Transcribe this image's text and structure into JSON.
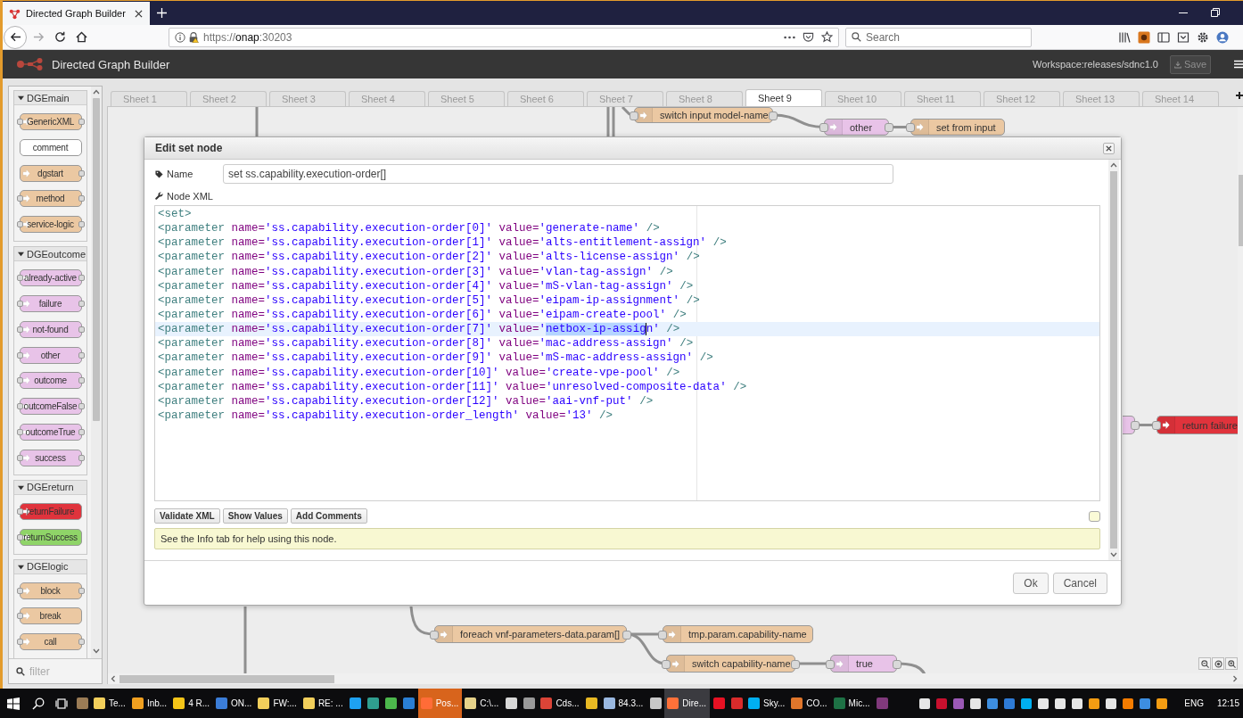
{
  "browser": {
    "tabs": [
      {
        "title": "Directed Graph Builder",
        "selected": true
      }
    ],
    "forward": {
      "disabled": true
    },
    "url": {
      "scheme": "https://",
      "host": "onap",
      "port": ":30203"
    },
    "search": {
      "placeholder": "Search"
    }
  },
  "app": {
    "title": "Directed Graph Builder",
    "workspace": "Workspace:releases/sdnc1.0",
    "save_button": {
      "label": "Save",
      "disabled": true
    }
  },
  "palette": {
    "categories": [
      {
        "name": "DGEmain",
        "expanded": true,
        "nodes": [
          {
            "label": "GenericXML",
            "kind": "node",
            "color": "#ebc8a2",
            "input": true,
            "output": true
          },
          {
            "label": "comment",
            "kind": "comment",
            "color": "#ffffff",
            "input": false,
            "output": false
          },
          {
            "label": "dgstart",
            "kind": "node",
            "color": "#ebc8a2",
            "input": false,
            "output": true
          },
          {
            "label": "method",
            "kind": "node",
            "color": "#ebc8a2",
            "input": true,
            "output": true
          },
          {
            "label": "service-logic",
            "kind": "node",
            "color": "#ebc8a2",
            "input": true,
            "output": true
          }
        ]
      },
      {
        "name": "DGEoutcome",
        "expanded": true,
        "nodes": [
          {
            "label": "already-active",
            "kind": "node",
            "color": "#e8c3e8",
            "input": true,
            "output": true
          },
          {
            "label": "failure",
            "kind": "node",
            "color": "#e8c3e8",
            "input": true,
            "output": true
          },
          {
            "label": "not-found",
            "kind": "node",
            "color": "#e8c3e8",
            "input": true,
            "output": true
          },
          {
            "label": "other",
            "kind": "node",
            "color": "#e8c3e8",
            "input": true,
            "output": true
          },
          {
            "label": "outcome",
            "kind": "node",
            "color": "#e8c3e8",
            "input": true,
            "output": true
          },
          {
            "label": "outcomeFalse",
            "kind": "node",
            "color": "#e8c3e8",
            "input": true,
            "output": true
          },
          {
            "label": "outcomeTrue",
            "kind": "node",
            "color": "#e8c3e8",
            "input": true,
            "output": true
          },
          {
            "label": "success",
            "kind": "node",
            "color": "#e8c3e8",
            "input": true,
            "output": true
          }
        ]
      },
      {
        "name": "DGEreturn",
        "expanded": true,
        "nodes": [
          {
            "label": "returnFailure",
            "kind": "node",
            "color": "#e0333c",
            "input": true,
            "output": false
          },
          {
            "label": "returnSuccess",
            "kind": "node",
            "color": "#8fd468",
            "input": true,
            "output": false
          }
        ]
      },
      {
        "name": "DGElogic",
        "expanded": true,
        "nodes": [
          {
            "label": "block",
            "kind": "node",
            "color": "#ebc8a2",
            "input": true,
            "output": true
          },
          {
            "label": "break",
            "kind": "node",
            "color": "#ebc8a2",
            "input": true,
            "output": false
          },
          {
            "label": "call",
            "kind": "node",
            "color": "#ebc8a2",
            "input": true,
            "output": true
          }
        ]
      }
    ],
    "filter": {
      "placeholder": "filter"
    }
  },
  "sheets": {
    "tabs": [
      {
        "label": "Sheet 1",
        "selected": false
      },
      {
        "label": "Sheet 2",
        "selected": false
      },
      {
        "label": "Sheet 3",
        "selected": false
      },
      {
        "label": "Sheet 4",
        "selected": false
      },
      {
        "label": "Sheet 5",
        "selected": false
      },
      {
        "label": "Sheet 6",
        "selected": false
      },
      {
        "label": "Sheet 7",
        "selected": false
      },
      {
        "label": "Sheet 8",
        "selected": false
      },
      {
        "label": "Sheet 9",
        "selected": true
      },
      {
        "label": "Sheet 10",
        "selected": false
      },
      {
        "label": "Sheet 11",
        "selected": false
      },
      {
        "label": "Sheet 12",
        "selected": false
      },
      {
        "label": "Sheet 13",
        "selected": false
      },
      {
        "label": "Sheet 14",
        "selected": false
      }
    ]
  },
  "canvas": {
    "nodes": [
      {
        "label": "switch input model-name",
        "color": "#ebc8a2",
        "input": true,
        "output": true
      },
      {
        "label": "other",
        "color": "#e8c3e8",
        "input": true,
        "output": true
      },
      {
        "label": "set from input",
        "color": "#ebc8a2",
        "input": true,
        "output": false
      },
      {
        "color": "#e8c3e8",
        "input": false,
        "output": true
      },
      {
        "label": "return failure",
        "color": "#e0333c",
        "input": true,
        "output": false
      },
      {
        "label": "foreach vnf-parameters-data.param[]",
        "color": "#ebc8a2",
        "input": true,
        "output": true
      },
      {
        "label": "tmp.param.capability-name",
        "color": "#ebc8a2",
        "input": true,
        "output": false
      },
      {
        "label": "switch capability-name",
        "color": "#ebc8a2",
        "input": true,
        "output": true
      },
      {
        "label": "true",
        "color": "#e8c3e8",
        "input": true,
        "output": true
      }
    ]
  },
  "dialog": {
    "title": "Edit set node",
    "name_field": {
      "label": "Name",
      "value": "set ss.capability.execution-order[]"
    },
    "editor": {
      "label": "Node XML",
      "lines": [
        {
          "current": false,
          "tokens": [
            {
              "kind": "tag",
              "text": "<set>"
            }
          ]
        },
        {
          "current": false,
          "tokens": [
            {
              "kind": "tag",
              "text": "<parameter"
            },
            {
              "kind": "attr",
              "text": " name="
            },
            {
              "kind": "string",
              "text": "'ss.capability.execution-order[0]'"
            },
            {
              "kind": "attr",
              "text": " value="
            },
            {
              "kind": "string",
              "text": "'generate-name'"
            },
            {
              "kind": "tag",
              "text": " />"
            }
          ]
        },
        {
          "current": false,
          "tokens": [
            {
              "kind": "tag",
              "text": "<parameter"
            },
            {
              "kind": "attr",
              "text": " name="
            },
            {
              "kind": "string",
              "text": "'ss.capability.execution-order[1]'"
            },
            {
              "kind": "attr",
              "text": " value="
            },
            {
              "kind": "string",
              "text": "'alts-entitlement-assign'"
            },
            {
              "kind": "tag",
              "text": " />"
            }
          ]
        },
        {
          "current": false,
          "tokens": [
            {
              "kind": "tag",
              "text": "<parameter"
            },
            {
              "kind": "attr",
              "text": " name="
            },
            {
              "kind": "string",
              "text": "'ss.capability.execution-order[2]'"
            },
            {
              "kind": "attr",
              "text": " value="
            },
            {
              "kind": "string",
              "text": "'alts-license-assign'"
            },
            {
              "kind": "tag",
              "text": " />"
            }
          ]
        },
        {
          "current": false,
          "tokens": [
            {
              "kind": "tag",
              "text": "<parameter"
            },
            {
              "kind": "attr",
              "text": " name="
            },
            {
              "kind": "string",
              "text": "'ss.capability.execution-order[3]'"
            },
            {
              "kind": "attr",
              "text": " value="
            },
            {
              "kind": "string",
              "text": "'vlan-tag-assign'"
            },
            {
              "kind": "tag",
              "text": " />"
            }
          ]
        },
        {
          "current": false,
          "tokens": [
            {
              "kind": "tag",
              "text": "<parameter"
            },
            {
              "kind": "attr",
              "text": " name="
            },
            {
              "kind": "string",
              "text": "'ss.capability.execution-order[4]'"
            },
            {
              "kind": "attr",
              "text": " value="
            },
            {
              "kind": "string",
              "text": "'mS-vlan-tag-assign'"
            },
            {
              "kind": "tag",
              "text": " />"
            }
          ]
        },
        {
          "current": false,
          "tokens": [
            {
              "kind": "tag",
              "text": "<parameter"
            },
            {
              "kind": "attr",
              "text": " name="
            },
            {
              "kind": "string",
              "text": "'ss.capability.execution-order[5]'"
            },
            {
              "kind": "attr",
              "text": " value="
            },
            {
              "kind": "string",
              "text": "'eipam-ip-assignment'"
            },
            {
              "kind": "tag",
              "text": " />"
            }
          ]
        },
        {
          "current": false,
          "tokens": [
            {
              "kind": "tag",
              "text": "<parameter"
            },
            {
              "kind": "attr",
              "text": " name="
            },
            {
              "kind": "string",
              "text": "'ss.capability.execution-order[6]'"
            },
            {
              "kind": "attr",
              "text": " value="
            },
            {
              "kind": "string",
              "text": "'eipam-create-pool'"
            },
            {
              "kind": "tag",
              "text": " />"
            }
          ]
        },
        {
          "current": true,
          "tokens": [
            {
              "kind": "tag",
              "text": "<parameter"
            },
            {
              "kind": "attr",
              "text": " name="
            },
            {
              "kind": "string",
              "text": "'ss.capability.execution-order[7]'"
            },
            {
              "kind": "attr",
              "text": " value="
            },
            {
              "kind": "string",
              "text": "'"
            },
            {
              "kind": "selection",
              "text": "netbox-ip-assig"
            },
            {
              "kind": "string",
              "text": "n'"
            },
            {
              "kind": "tag",
              "text": " />"
            }
          ]
        },
        {
          "current": false,
          "tokens": [
            {
              "kind": "tag",
              "text": "<parameter"
            },
            {
              "kind": "attr",
              "text": " name="
            },
            {
              "kind": "string",
              "text": "'ss.capability.execution-order[8]'"
            },
            {
              "kind": "attr",
              "text": " value="
            },
            {
              "kind": "string",
              "text": "'mac-address-assign'"
            },
            {
              "kind": "tag",
              "text": " />"
            }
          ]
        },
        {
          "current": false,
          "tokens": [
            {
              "kind": "tag",
              "text": "<parameter"
            },
            {
              "kind": "attr",
              "text": " name="
            },
            {
              "kind": "string",
              "text": "'ss.capability.execution-order[9]'"
            },
            {
              "kind": "attr",
              "text": " value="
            },
            {
              "kind": "string",
              "text": "'mS-mac-address-assign'"
            },
            {
              "kind": "tag",
              "text": " />"
            }
          ]
        },
        {
          "current": false,
          "tokens": [
            {
              "kind": "tag",
              "text": "<parameter"
            },
            {
              "kind": "attr",
              "text": " name="
            },
            {
              "kind": "string",
              "text": "'ss.capability.execution-order[10]'"
            },
            {
              "kind": "attr",
              "text": " value="
            },
            {
              "kind": "string",
              "text": "'create-vpe-pool'"
            },
            {
              "kind": "tag",
              "text": " />"
            }
          ]
        },
        {
          "current": false,
          "tokens": [
            {
              "kind": "tag",
              "text": "<parameter"
            },
            {
              "kind": "attr",
              "text": " name="
            },
            {
              "kind": "string",
              "text": "'ss.capability.execution-order[11]'"
            },
            {
              "kind": "attr",
              "text": " value="
            },
            {
              "kind": "string",
              "text": "'unresolved-composite-data'"
            },
            {
              "kind": "tag",
              "text": " />"
            }
          ]
        },
        {
          "current": false,
          "tokens": [
            {
              "kind": "tag",
              "text": "<parameter"
            },
            {
              "kind": "attr",
              "text": " name="
            },
            {
              "kind": "string",
              "text": "'ss.capability.execution-order[12]'"
            },
            {
              "kind": "attr",
              "text": " value="
            },
            {
              "kind": "string",
              "text": "'aai-vnf-put'"
            },
            {
              "kind": "tag",
              "text": " />"
            }
          ]
        },
        {
          "current": false,
          "tokens": [
            {
              "kind": "tag",
              "text": "<parameter"
            },
            {
              "kind": "attr",
              "text": " name="
            },
            {
              "kind": "string",
              "text": "'ss.capability.execution-order_length'"
            },
            {
              "kind": "attr",
              "text": " value="
            },
            {
              "kind": "string",
              "text": "'13'"
            },
            {
              "kind": "tag",
              "text": " />"
            }
          ]
        }
      ]
    },
    "tools": [
      {
        "label": "Validate XML"
      },
      {
        "label": "Show Values"
      },
      {
        "label": "Add Comments"
      }
    ],
    "tip": "See the Info tab for help using this node.",
    "buttons": [
      {
        "label": "Ok"
      },
      {
        "label": "Cancel"
      }
    ]
  },
  "taskbar": {
    "apps": [
      {
        "color": "#9a7b55",
        "active": false,
        "flashing": false
      },
      {
        "label": "Te...",
        "color": "#f2cf5b",
        "active": false,
        "flashing": false
      },
      {
        "label": "Inb...",
        "color": "#f0a020",
        "active": false,
        "flashing": false
      },
      {
        "label": "4 R...",
        "color": "#f5c518",
        "active": false,
        "flashing": false
      },
      {
        "label": "ON...",
        "color": "#3b7dd8",
        "active": false,
        "flashing": false
      },
      {
        "label": "FW:...",
        "color": "#f2cf5b",
        "active": false,
        "flashing": false
      },
      {
        "label": "RE: ...",
        "color": "#f2cf5b",
        "active": false,
        "flashing": false
      },
      {
        "color": "#1ea1f1",
        "active": false,
        "flashing": false
      },
      {
        "color": "#2f9e8f",
        "active": false,
        "flashing": false
      },
      {
        "color": "#4cb84c",
        "active": false,
        "flashing": false
      },
      {
        "color": "#2a7fd4",
        "active": false,
        "flashing": false
      },
      {
        "label": "Pos...",
        "color": "#ff6c37",
        "active": false,
        "flashing": true
      },
      {
        "label": "C:\\...",
        "color": "#e6d28a",
        "active": false,
        "flashing": false
      },
      {
        "color": "#d8d8d8",
        "active": false,
        "flashing": false
      },
      {
        "color": "#9a9a9a",
        "active": false,
        "flashing": false
      },
      {
        "label": "Cds...",
        "color": "#db4437",
        "active": false,
        "flashing": false
      },
      {
        "color": "#e8b923",
        "active": false,
        "flashing": false
      },
      {
        "label": "84.3...",
        "color": "#9ab8e0",
        "active": false,
        "flashing": false
      },
      {
        "color": "#c8c8c8",
        "active": false,
        "flashing": false
      },
      {
        "label": "Dire...",
        "color": "#ff7139",
        "active": true,
        "flashing": false
      },
      {
        "color": "#e81123",
        "active": false,
        "flashing": false
      },
      {
        "color": "#d92b2b",
        "active": false,
        "flashing": false
      },
      {
        "label": "Sky...",
        "color": "#00aff0",
        "active": false,
        "flashing": false
      },
      {
        "label": "CO...",
        "color": "#e0762b",
        "active": false,
        "flashing": false
      },
      {
        "label": "Mic...",
        "color": "#1e7145",
        "active": false,
        "flashing": false
      },
      {
        "color": "#80397b",
        "active": false,
        "flashing": false
      }
    ],
    "tray": [
      {
        "color": "#e6e6e6"
      },
      {
        "color": "#c8102e"
      },
      {
        "color": "#9b59b6"
      },
      {
        "color": "#e6e6e6"
      },
      {
        "color": "#3d8ee0"
      },
      {
        "color": "#2e7bd6"
      },
      {
        "color": "#00aff0"
      },
      {
        "color": "#e6e6e6"
      },
      {
        "color": "#e6e6e6"
      },
      {
        "color": "#e6e6e6"
      },
      {
        "color": "#f39c12"
      },
      {
        "color": "#e6e6e6"
      },
      {
        "color": "#f57c00"
      },
      {
        "color": "#3d8ee0"
      },
      {
        "color": "#f39c12"
      }
    ],
    "language": "ENG",
    "time": "12:15"
  }
}
